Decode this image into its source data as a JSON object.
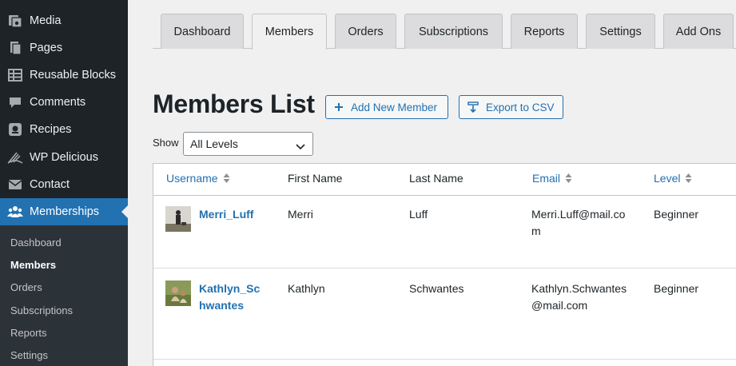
{
  "sidebar": {
    "items": [
      {
        "label": "Media",
        "icon": "media-icon"
      },
      {
        "label": "Pages",
        "icon": "pages-icon"
      },
      {
        "label": "Reusable Blocks",
        "icon": "reusable-blocks-icon"
      },
      {
        "label": "Comments",
        "icon": "comments-icon"
      },
      {
        "label": "Recipes",
        "icon": "recipes-icon"
      },
      {
        "label": "WP Delicious",
        "icon": "wp-delicious-icon"
      },
      {
        "label": "Contact",
        "icon": "contact-icon"
      },
      {
        "label": "Memberships",
        "icon": "memberships-icon"
      }
    ],
    "submenu": [
      "Dashboard",
      "Members",
      "Orders",
      "Subscriptions",
      "Reports",
      "Settings"
    ],
    "current_submenu": "Members"
  },
  "tabs": [
    "Dashboard",
    "Members",
    "Orders",
    "Subscriptions",
    "Reports",
    "Settings",
    "Add Ons"
  ],
  "active_tab": "Members",
  "page": {
    "title": "Members List",
    "add_button": "Add New Member",
    "export_button": "Export to CSV",
    "show_label": "Show",
    "level_filter": "All Levels"
  },
  "table": {
    "columns": [
      "Username",
      "First Name",
      "Last Name",
      "Email",
      "Level"
    ],
    "rows": [
      {
        "username_1": "Merri_Luff",
        "username_2": "",
        "first": "Merri",
        "last": "Luff",
        "email_1": "Merri.Luff@mail.co",
        "email_2": "m",
        "level": "Beginner"
      },
      {
        "username_1": "Kathlyn_Sc",
        "username_2": "hwantes",
        "first": "Kathlyn",
        "last": "Schwantes",
        "email_1": "Kathlyn.Schwantes",
        "email_2": "@mail.com",
        "level": "Beginner"
      }
    ]
  },
  "colors": {
    "sidebar": "#1d2327",
    "accent": "#2271b1",
    "background": "#f0f0f1"
  }
}
